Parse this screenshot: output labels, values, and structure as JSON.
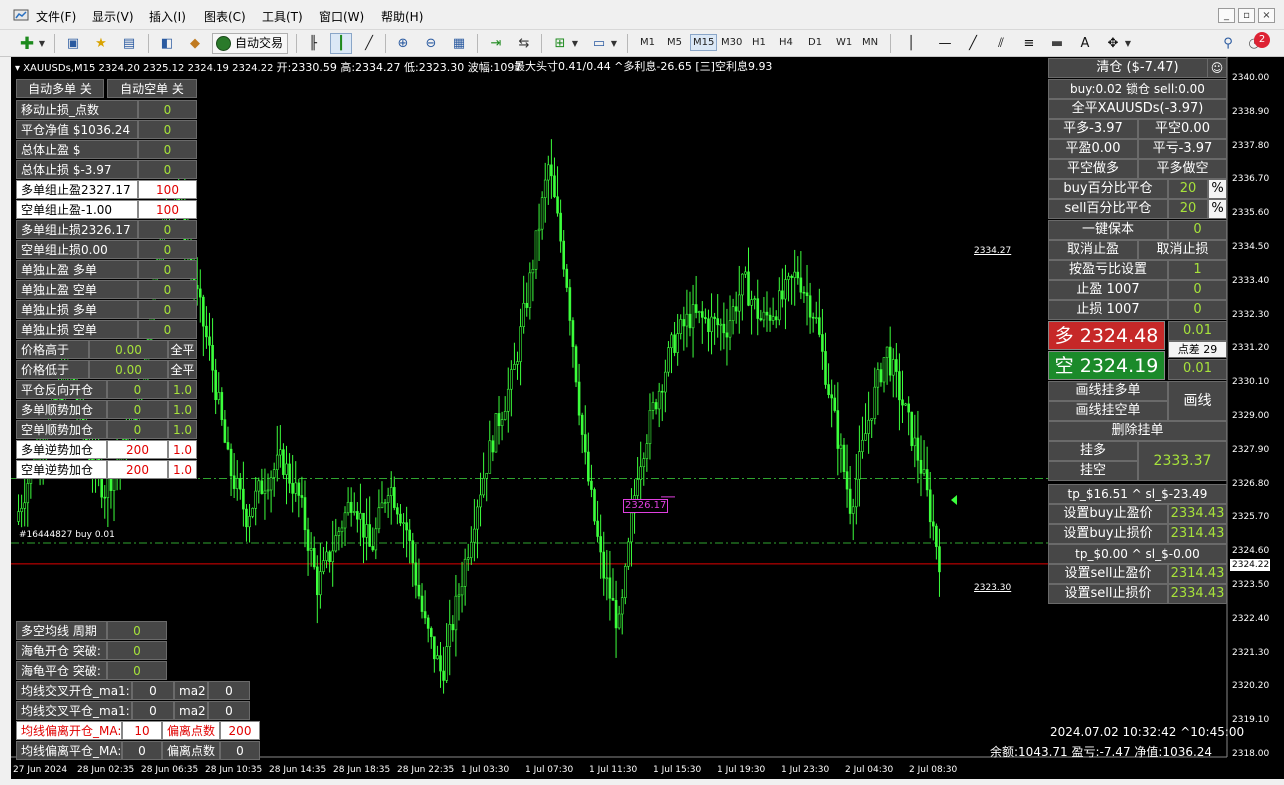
{
  "menubar": {
    "items": [
      "文件(F)",
      "显示(V)",
      "插入(I)",
      "图表(C)",
      "工具(T)",
      "窗口(W)",
      "帮助(H)"
    ]
  },
  "toolbar": {
    "autotrade_label": "自动交易",
    "timeframes": [
      "M1",
      "M5",
      "M15",
      "M30",
      "H1",
      "H4",
      "D1",
      "W1",
      "MN"
    ],
    "active_timeframe": "M15",
    "notification_count": "2"
  },
  "chart": {
    "title": "XAUUSDs,M15  2324.20 2325.12 2324.19 2324.22",
    "ohlc_text": "开:2330.59 高:2334.27 低:2323.30 波幅:1097",
    "info_center": "最大头寸0.41/0.44 ^多利息-26.65 [三]空利息9.93",
    "high_label": "2334.27",
    "low_label": "2323.30",
    "order_line_label": "#16444827 buy 0.01",
    "pending_label": "2326.17",
    "current_price_tag": "2324.22",
    "datetime": "2024.07.02 10:32:42 ^10:45:00",
    "account": "余额:1043.71 盈亏:-7.47 净值:1036.24",
    "colors": {
      "candle": "#3cff3c",
      "grid_dash": "#2fa52f",
      "red_line": "#e00000",
      "bg": "#000000"
    }
  },
  "chart_data": {
    "type": "candlestick",
    "symbol": "XAUUSDs",
    "timeframe": "M15",
    "ylim": [
      2318.0,
      2340.0
    ],
    "y_ticks": [
      "2340.00",
      "2338.90",
      "2337.80",
      "2336.70",
      "2335.60",
      "2334.50",
      "2333.40",
      "2332.30",
      "2331.20",
      "2330.10",
      "2329.00",
      "2327.90",
      "2326.80",
      "2325.70",
      "2324.60",
      "2323.50",
      "2322.40",
      "2321.30",
      "2320.20",
      "2319.10",
      "2318.00"
    ],
    "x_ticks": [
      "27 Jun 2024",
      "28 Jun 02:35",
      "28 Jun 06:35",
      "28 Jun 10:35",
      "28 Jun 14:35",
      "28 Jun 18:35",
      "28 Jun 22:35",
      "1 Jul 03:30",
      "1 Jul 07:30",
      "1 Jul 11:30",
      "1 Jul 15:30",
      "1 Jul 19:30",
      "1 Jul 23:30",
      "2 Jul 04:30",
      "2 Jul 08:30"
    ],
    "horizontal_lines": [
      {
        "price": 2327.0,
        "style": "dash-dot",
        "color": "#2fa52f"
      },
      {
        "price": 2324.9,
        "style": "dash-dot",
        "color": "#2fa52f"
      },
      {
        "price": 2324.22,
        "style": "solid",
        "color": "#e00000"
      }
    ],
    "close_path": [
      2325.6,
      2327.5,
      2329.2,
      2330.4,
      2328.1,
      2326.6,
      2327.8,
      2329.4,
      2334.6,
      2336.7,
      2333.5,
      2330.9,
      2327.4,
      2325.8,
      2326.9,
      2327.6,
      2326.3,
      2323.5,
      2325.0,
      2326.5,
      2324.6,
      2326.9,
      2325.4,
      2322.3,
      2320.6,
      2323.4,
      2326.3,
      2328.6,
      2330.3,
      2333.6,
      2337.2,
      2333.6,
      2327.8,
      2324.1,
      2322.1,
      2327.3,
      2329.5,
      2331.4,
      2332.3,
      2332.1,
      2331.9,
      2333.4,
      2332.1,
      2332.7,
      2333.7,
      2332.3,
      2329.2,
      2326.1,
      2328.9,
      2331.2,
      2329.3,
      2327.3,
      2324.4
    ]
  },
  "left_panel": {
    "btn_auto_long": "自动多单 关",
    "btn_auto_short": "自动空单 关",
    "rows": [
      {
        "label": "移动止损_点数",
        "value": "0"
      },
      {
        "label": "平仓净值 $1036.24",
        "value": "0"
      },
      {
        "label": "总体止盈 $",
        "value": "0"
      },
      {
        "label": "总体止损 $-3.97",
        "value": "0"
      },
      {
        "label": "多单组止盈2327.17",
        "value": "100"
      },
      {
        "label": "空单组止盈-1.00",
        "value": "100"
      },
      {
        "label": "多单组止损2326.17",
        "value": "0"
      },
      {
        "label": "空单组止损0.00",
        "value": "0"
      },
      {
        "label": "单独止盈 多单",
        "value": "0"
      },
      {
        "label": "单独止盈 空单",
        "value": "0"
      },
      {
        "label": "单独止损 多单",
        "value": "0"
      },
      {
        "label": "单独止损 空单",
        "value": "0"
      }
    ],
    "price_above_label": "价格高于",
    "price_above_value": "0.00",
    "price_below_label": "价格低于",
    "price_below_value": "0.00",
    "close_all": "全平",
    "ratio_rows": [
      {
        "label": "平仓反向开仓",
        "value": "0",
        "ratio": "1.0"
      },
      {
        "label": "多单顺势加仓",
        "value": "0",
        "ratio": "1.0"
      },
      {
        "label": "空单顺势加仓",
        "value": "0",
        "ratio": "1.0"
      },
      {
        "label": "多单逆势加仓",
        "value": "200",
        "ratio": "1.0"
      },
      {
        "label": "空单逆势加仓",
        "value": "200",
        "ratio": "1.0"
      }
    ],
    "ma_period_label": "多空均线 周期",
    "ma_period_value": "0",
    "turtle_open_label": "海龟开仓 突破:",
    "turtle_open_value": "0",
    "turtle_close_label": "海龟平仓 突破:",
    "turtle_close_value": "0",
    "cross_open_label": "均线交叉开仓_ma1:",
    "cross_open_ma1": "0",
    "cross_close_label": "均线交叉平仓_ma1:",
    "cross_close_ma1": "0",
    "ma2_label": "ma2:",
    "cross_open_ma2": "0",
    "cross_close_ma2": "0",
    "dev_open_label": "均线偏离开仓_MA:",
    "dev_open_ma": "10",
    "dev_points_label": "偏离点数",
    "dev_open_points": "200",
    "dev_close_label": "均线偏离平仓_MA:",
    "dev_close_ma": "0",
    "dev_close_points": "0"
  },
  "right_panel": {
    "close_all": "清仓 ($-7.47)",
    "lock_info": "buy:0.02 锁仓 sell:0.00",
    "close_symbol": "全平XAUUSDs(-3.97)",
    "close_long": "平多-3.97",
    "close_short": "平空0.00",
    "close_profit": "平盈0.00",
    "close_loss": "平亏-3.97",
    "flat_short_open_long": "平空做多",
    "flat_long_open_short": "平多做空",
    "buy_pct_close": "buy百分比平仓",
    "buy_pct_value": "20",
    "sell_pct_close": "sell百分比平仓",
    "sell_pct_value": "20",
    "pct_sign": "%",
    "breakeven": "一键保本",
    "breakeven_value": "0",
    "cancel_tp": "取消止盈",
    "cancel_sl": "取消止损",
    "rr_setting": "按盈亏比设置",
    "rr_value": "1",
    "tp_label": "止盈 1007",
    "tp_value": "0",
    "sl_label": "止损 1007",
    "sl_value": "0",
    "buy_prefix": "多",
    "buy_price": "2324.48",
    "lot_buy": "0.01",
    "spread": "点差 29",
    "sell_prefix": "空",
    "sell_price": "2324.19",
    "lot_sell": "0.01",
    "draw_buy_limit": "画线挂多单",
    "draw_sell_limit": "画线挂空单",
    "draw_line": "画线",
    "delete_pending": "删除挂单",
    "pending_long": "挂多",
    "pending_short": "挂空",
    "pending_price": "2333.37",
    "buy_tp_sl_info": "tp_$16.51 ^ sl_$-23.49",
    "set_buy_tp": "设置buy止盈价",
    "set_buy_tp_value": "2334.43",
    "set_buy_sl": "设置buy止损价",
    "set_buy_sl_value": "2314.43",
    "sell_tp_sl_info": "tp_$0.00 ^ sl_$-0.00",
    "set_sell_tp": "设置sell止盈价",
    "set_sell_tp_value": "2314.43",
    "set_sell_sl": "设置sell止损价",
    "set_sell_sl_value": "2334.43"
  }
}
